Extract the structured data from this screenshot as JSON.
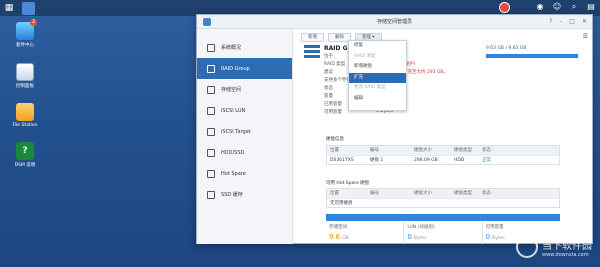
{
  "desktop_icons": [
    {
      "label": "套件中心",
      "badge": "2"
    },
    {
      "label": "控制面板"
    },
    {
      "label": "File Station"
    },
    {
      "label": "DSM 说明"
    }
  ],
  "window": {
    "title": "存储空间管理员",
    "sidebar": [
      {
        "label": "系统概况"
      },
      {
        "label": "RAID Group"
      },
      {
        "label": "存储空间"
      },
      {
        "label": "iSCSI LUN"
      },
      {
        "label": "iSCSI Target"
      },
      {
        "label": "HDD/SSD"
      },
      {
        "label": "Hot Spare"
      },
      {
        "label": "SSD 缓存"
      }
    ],
    "toolbar": {
      "create": "新增",
      "delete": "删除",
      "manage": "管理 ▾"
    },
    "raid_title": "RAID G",
    "capacity_text": "9.63 GB / 9.63 GB",
    "info": [
      {
        "k": "位于",
        "v": "存储空间"
      },
      {
        "k": "RAID 类型",
        "v": "Basic (无数据保护)"
      },
      {
        "k": "建议",
        "v": "您可以再新增扩充至大约 293 GB。"
      },
      {
        "k": "支持多个存储",
        "v": "否"
      },
      {
        "k": "状态",
        "v": "正常"
      },
      {
        "k": "容量",
        "v": "9.63 GB"
      },
      {
        "k": "已用容量",
        "v": "9.63 GB"
      },
      {
        "k": "可用容量",
        "v": "0 Bytes"
      }
    ],
    "menu": [
      {
        "label": "修复"
      },
      {
        "label": "RAID 清理"
      },
      {
        "label": "新增硬盘"
      },
      {
        "label": "扩充"
      },
      {
        "label": "更改 RAID 类型"
      },
      {
        "label": "编辑"
      }
    ],
    "disk_section": "硬盘信息",
    "disk_headers": [
      "位置",
      "编号",
      "硬盘大小",
      "硬盘类型",
      "状态"
    ],
    "disk_rows": [
      [
        "DS3617XS",
        "硬盘 1",
        "298.09 GB",
        "HDD",
        "正常"
      ]
    ],
    "hotspare_section": "可用 Hot Spare 硬盘",
    "hotspare_headers": [
      "位置",
      "编号",
      "硬盘大小",
      "硬盘类型",
      "状态"
    ],
    "hotspare_empty": "无可用硬盘",
    "stats": [
      {
        "label": "存储空间",
        "value": "9.6",
        "unit": "GB"
      },
      {
        "label": "LUN (块级别)",
        "value": "0",
        "unit": "Bytes"
      },
      {
        "label": "可用容量",
        "value": "0",
        "unit": "Bytes"
      }
    ]
  },
  "watermark": {
    "title": "当下软件园",
    "sub": "www.downxia.com"
  }
}
